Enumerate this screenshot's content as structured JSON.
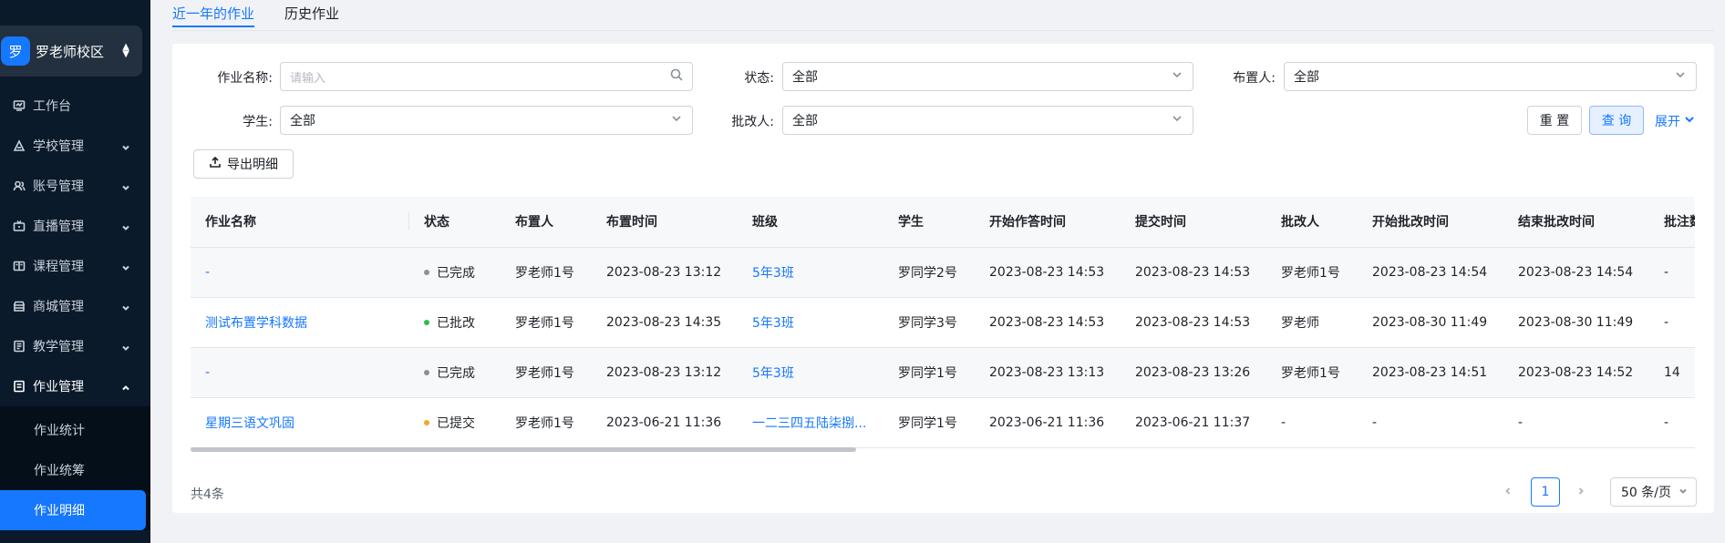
{
  "sidebar": {
    "school_logo_char": "罗",
    "school_name": "罗老师校区",
    "items": [
      {
        "label": "工作台",
        "icon": "dashboard-icon"
      },
      {
        "label": "学校管理",
        "icon": "school-icon"
      },
      {
        "label": "账号管理",
        "icon": "account-icon"
      },
      {
        "label": "直播管理",
        "icon": "live-icon"
      },
      {
        "label": "课程管理",
        "icon": "course-icon"
      },
      {
        "label": "商城管理",
        "icon": "shop-icon"
      },
      {
        "label": "教学管理",
        "icon": "teaching-icon"
      },
      {
        "label": "作业管理",
        "icon": "homework-icon"
      }
    ],
    "submenu": [
      {
        "label": "作业统计"
      },
      {
        "label": "作业统筹"
      },
      {
        "label": "作业明细"
      }
    ]
  },
  "tabs": [
    {
      "label": "近一年的作业"
    },
    {
      "label": "历史作业"
    }
  ],
  "filters": {
    "homework_name_label": "作业名称:",
    "homework_name_placeholder": "请输入",
    "status_label": "状态:",
    "status_value": "全部",
    "assigner_label": "布置人:",
    "assigner_value": "全部",
    "student_label": "学生:",
    "student_value": "全部",
    "grader_label": "批改人:",
    "grader_value": "全部",
    "reset_label": "重 置",
    "query_label": "查 询",
    "expand_label": "展开",
    "export_label": "导出明细"
  },
  "table": {
    "columns": [
      "作业名称",
      "状态",
      "布置人",
      "布置时间",
      "班级",
      "学生",
      "开始作答时间",
      "提交时间",
      "批改人",
      "开始批改时间",
      "结束批改时间",
      "批注数"
    ],
    "rows": [
      {
        "name": "-",
        "status": "已完成",
        "status_color": "#8a8f99",
        "assigner": "罗老师1号",
        "assign_time": "2023-08-23 13:12",
        "class": "5年3班",
        "student": "罗同学2号",
        "start_time": "2023-08-23 14:53",
        "submit_time": "2023-08-23 14:53",
        "grader": "罗老师1号",
        "grade_start": "2023-08-23 14:54",
        "grade_end": "2023-08-23 14:54",
        "notes": "-"
      },
      {
        "name": "测试布置学科数据",
        "status": "已批改",
        "status_color": "#2dbd4e",
        "assigner": "罗老师1号",
        "assign_time": "2023-08-23 14:35",
        "class": "5年3班",
        "student": "罗同学3号",
        "start_time": "2023-08-23 14:53",
        "submit_time": "2023-08-23 14:53",
        "grader": "罗老师",
        "grade_start": "2023-08-30 11:49",
        "grade_end": "2023-08-30 11:49",
        "notes": "-"
      },
      {
        "name": "-",
        "status": "已完成",
        "status_color": "#8a8f99",
        "assigner": "罗老师1号",
        "assign_time": "2023-08-23 13:12",
        "class": "5年3班",
        "student": "罗同学1号",
        "start_time": "2023-08-23 13:13",
        "submit_time": "2023-08-23 13:26",
        "grader": "罗老师1号",
        "grade_start": "2023-08-23 14:51",
        "grade_end": "2023-08-23 14:52",
        "notes": "14"
      },
      {
        "name": "星期三语文巩固",
        "status": "已提交",
        "status_color": "#f5a623",
        "assigner": "罗老师1号",
        "assign_time": "2023-06-21 11:36",
        "class": "一二三四五陆柒捌...",
        "student": "罗同学1号",
        "start_time": "2023-06-21 11:36",
        "submit_time": "2023-06-21 11:37",
        "grader": "-",
        "grade_start": "-",
        "grade_end": "-",
        "notes": "-"
      }
    ]
  },
  "pagination": {
    "total": "共4条",
    "current_page": "1",
    "page_size": "50 条/页"
  },
  "colors": {
    "primary": "#1677ff",
    "sidebar_bg": "#0b1a2a"
  }
}
